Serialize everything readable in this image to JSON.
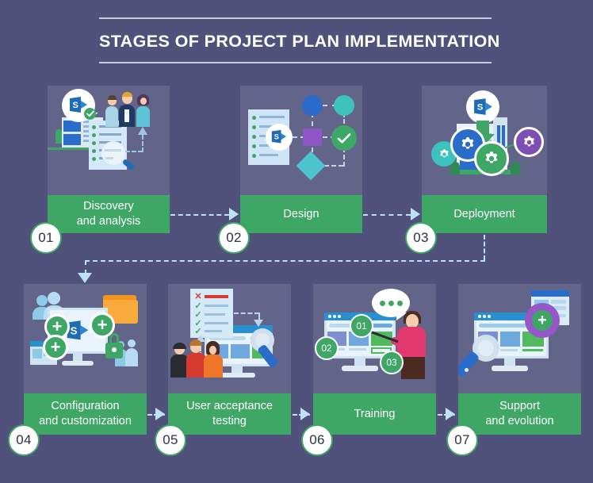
{
  "header": {
    "title": "STAGES OF PROJECT PLAN IMPLEMENTATION"
  },
  "colors": {
    "background": "#50527c",
    "card_art": "#63648a",
    "label_green": "#3fa765",
    "connector": "#bfe0f5",
    "badge_text": "#2f3145",
    "title_rule": "#c9cbe0",
    "sharepoint_blue": "#1e6cb3",
    "gear_teal": "#3ec2bd",
    "gear_blue": "#2a6cc9",
    "gear_green": "#3fa765",
    "gear_purple": "#7d4fb5",
    "accent_orange": "#f0961e",
    "accent_pink": "#e23a6e",
    "accent_red": "#d6392f"
  },
  "stages": [
    {
      "number": "01",
      "label": "Discovery\nand analysis",
      "label_line1": "Discovery",
      "label_line2": "and analysis",
      "row": "top",
      "icons": [
        "sharepoint-speech-bubble-icon",
        "business-people-icon",
        "office-building-icon",
        "document-magnifier-icon"
      ]
    },
    {
      "number": "02",
      "label": "Design",
      "label_line1": "Design",
      "label_line2": "",
      "row": "top",
      "icons": [
        "document-sharepoint-icon",
        "flowchart-diagram-icon",
        "check-circle-icon"
      ]
    },
    {
      "number": "03",
      "label": "Deployment",
      "label_line1": "Deployment",
      "label_line2": "",
      "row": "top",
      "icons": [
        "sharepoint-circle-icon",
        "down-arrow-icon",
        "office-building-icon",
        "gear-icon"
      ]
    },
    {
      "number": "04",
      "label": "Configuration\nand customization",
      "label_line1": "Configuration",
      "label_line2": "and customization",
      "row": "bottom",
      "icons": [
        "monitor-sharepoint-icon",
        "plus-circle-icon",
        "folder-icon",
        "lock-icon",
        "users-icon"
      ]
    },
    {
      "number": "05",
      "label": "User acceptance\ntesting",
      "label_line1": "User acceptance",
      "label_line2": "testing",
      "row": "bottom",
      "icons": [
        "checklist-icon",
        "monitor-icon",
        "wrench-icon",
        "people-group-icon"
      ]
    },
    {
      "number": "06",
      "label": "Training",
      "label_line1": "Training",
      "label_line2": "",
      "row": "bottom",
      "icons": [
        "monitor-icon",
        "speech-bubble-icon",
        "presenter-person-icon",
        "step-number-badge"
      ]
    },
    {
      "number": "07",
      "label": "Support\nand evolution",
      "label_line1": "Support",
      "label_line2": "and evolution",
      "row": "bottom",
      "icons": [
        "monitor-icon",
        "gear-plus-icon",
        "wrench-icon",
        "browser-window-icon"
      ]
    }
  ],
  "training_steps": [
    "01",
    "02",
    "03"
  ],
  "flow": {
    "arrows": [
      "stage1-to-stage2",
      "stage2-to-stage3",
      "stage3-to-stage4",
      "stage4-to-stage5",
      "stage5-to-stage6",
      "stage6-to-stage7"
    ]
  }
}
